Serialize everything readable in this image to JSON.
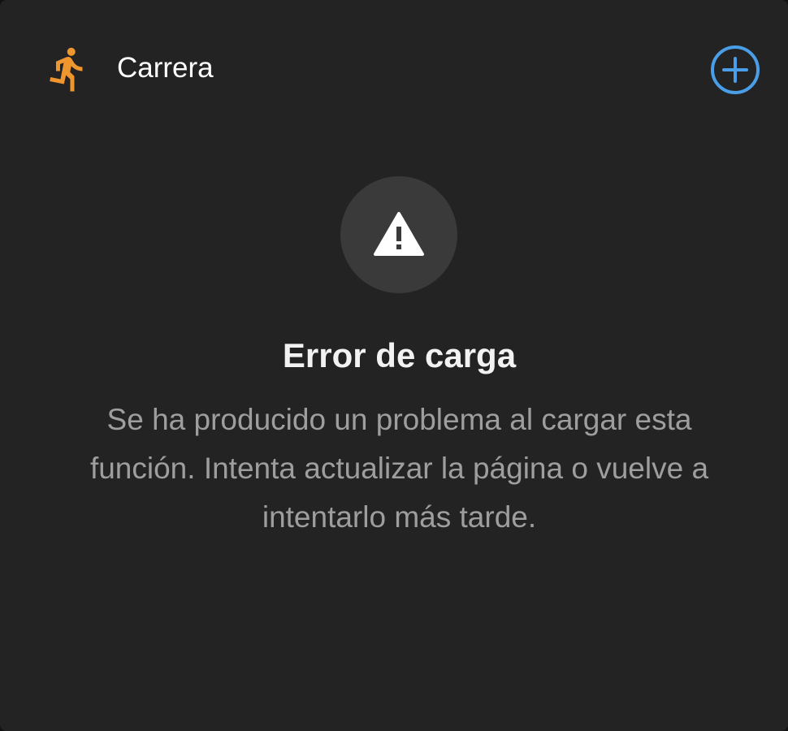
{
  "header": {
    "title": "Carrera",
    "run_icon": "running-person-icon",
    "add_icon": "add-circle-icon"
  },
  "error": {
    "icon": "warning-icon",
    "title": "Error de carga",
    "message": "Se ha producido un problema al cargar esta función. Intenta actualizar la página o vuelve a intentarlo más tarde."
  },
  "colors": {
    "background": "#232323",
    "accent_orange": "#f0962e",
    "accent_blue": "#4a9ee8",
    "title_text": "#ffffff",
    "body_text": "#9e9e9e",
    "icon_circle": "#3a3a3a"
  }
}
